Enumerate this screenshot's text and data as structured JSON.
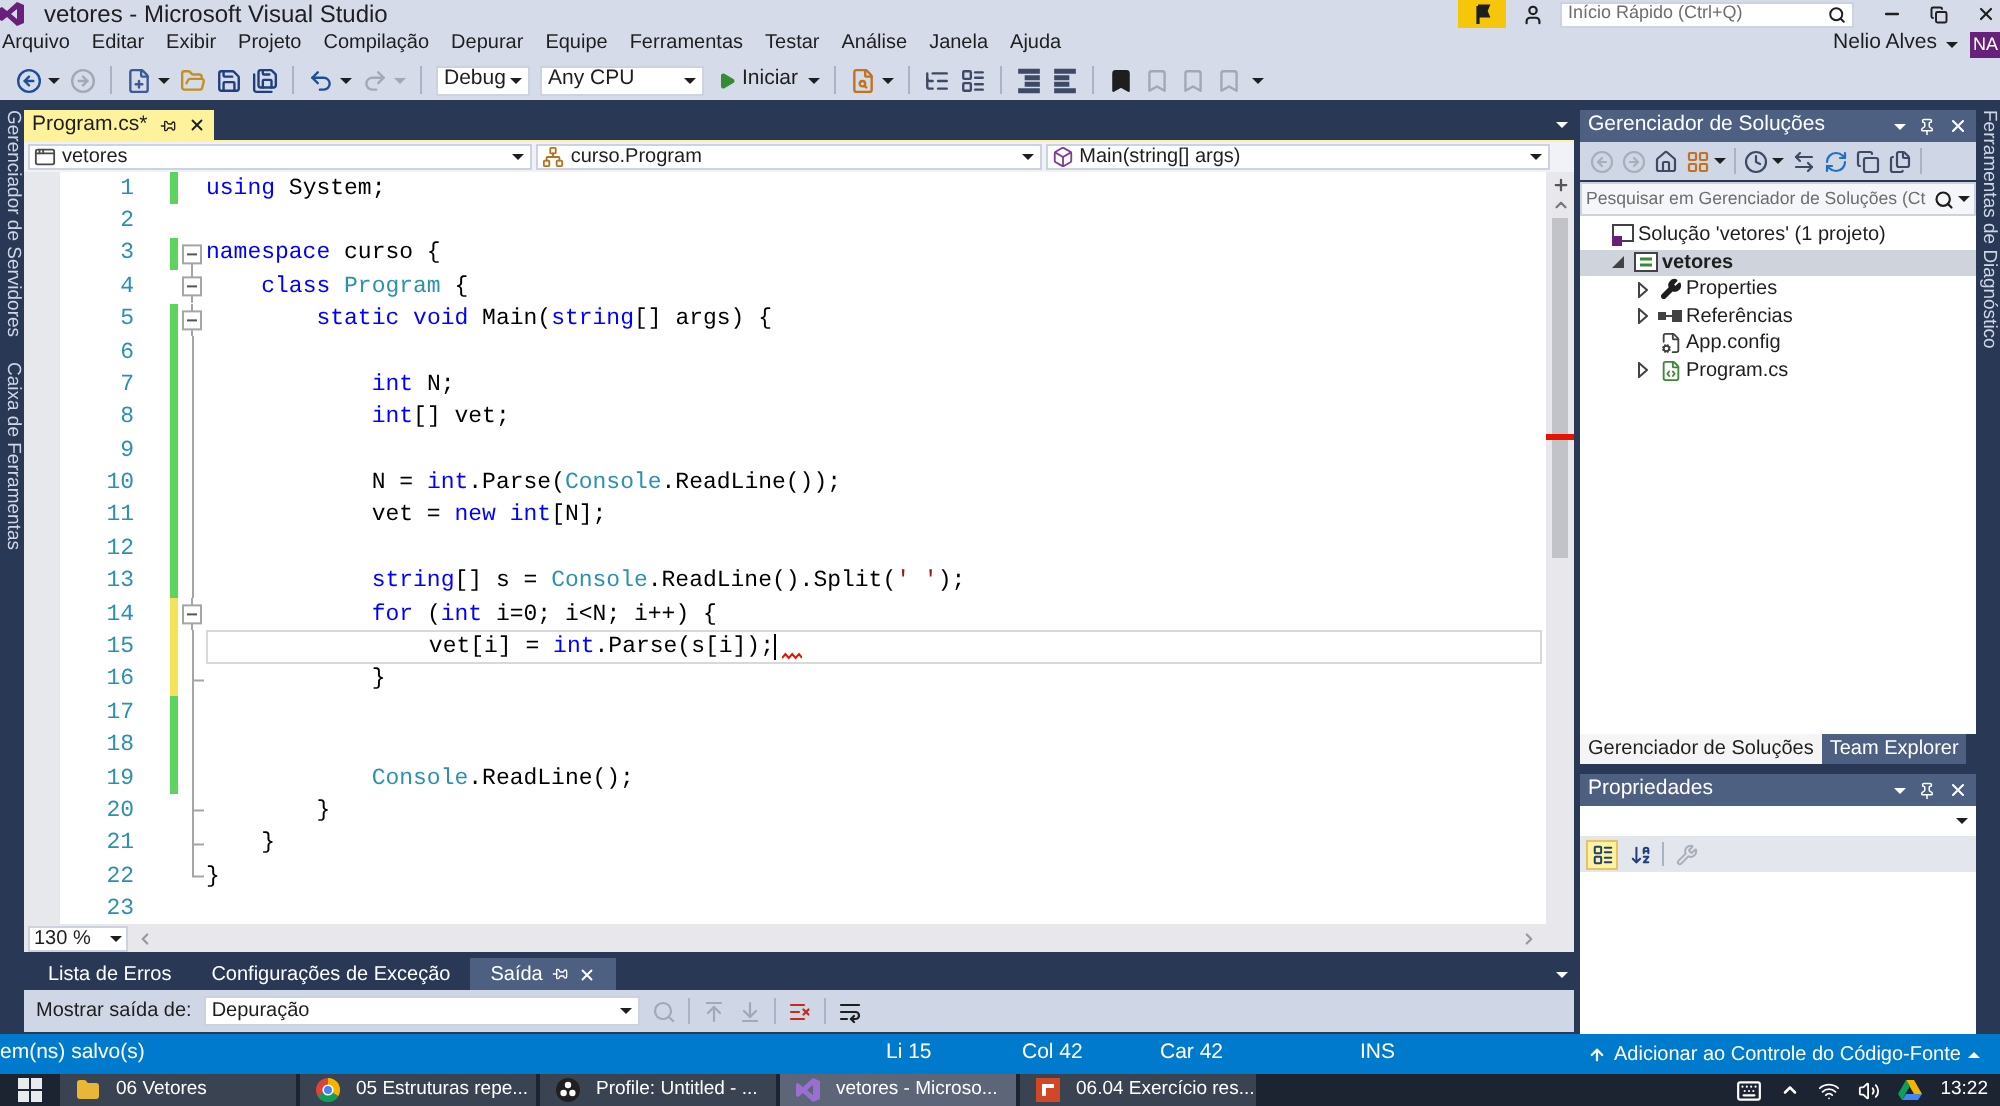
{
  "window": {
    "title": "vetores - Microsoft Visual Studio",
    "quick_launch": {
      "placeholder": "Início Rápido (Ctrl+Q)"
    }
  },
  "menu": [
    "Arquivo",
    "Editar",
    "Exibir",
    "Projeto",
    "Compilação",
    "Depurar",
    "Equipe",
    "Ferramentas",
    "Testar",
    "Análise",
    "Janela",
    "Ajuda"
  ],
  "account": {
    "name": "Nelio Alves",
    "initials": "NA"
  },
  "toolbar": [
    {
      "kind": "back",
      "disabled": false,
      "dropdown": true
    },
    {
      "kind": "forward",
      "disabled": true,
      "dropdown": false
    },
    {
      "kind": "separator"
    },
    {
      "kind": "new-project",
      "disabled": false,
      "dropdown": true
    },
    {
      "kind": "open",
      "disabled": false,
      "dropdown": false
    },
    {
      "kind": "save",
      "disabled": false,
      "dropdown": false
    },
    {
      "kind": "save-all",
      "disabled": false,
      "dropdown": false
    },
    {
      "kind": "separator"
    },
    {
      "kind": "undo",
      "disabled": false,
      "dropdown": true
    },
    {
      "kind": "redo",
      "disabled": true,
      "dropdown": true
    },
    {
      "kind": "separator"
    },
    {
      "kind": "select",
      "value": "Debug"
    },
    {
      "kind": "select",
      "value": "Any CPU"
    },
    {
      "kind": "start",
      "label": "Iniciar",
      "dropdown": true
    },
    {
      "kind": "separator"
    },
    {
      "kind": "find",
      "disabled": false,
      "dropdown": true
    },
    {
      "kind": "separator"
    },
    {
      "kind": "tree",
      "disabled": false,
      "dropdown": false
    },
    {
      "kind": "list",
      "disabled": false,
      "dropdown": false
    },
    {
      "kind": "separator"
    },
    {
      "kind": "comment",
      "disabled": false,
      "dropdown": false
    },
    {
      "kind": "uncomment",
      "disabled": false,
      "dropdown": false
    },
    {
      "kind": "separator"
    },
    {
      "kind": "bookmark",
      "disabled": false,
      "dropdown": false
    },
    {
      "kind": "bookmark-prev",
      "disabled": true,
      "dropdown": false
    },
    {
      "kind": "bookmark-next",
      "disabled": true,
      "dropdown": false
    },
    {
      "kind": "bookmark-clear",
      "disabled": true,
      "dropdown": false
    },
    {
      "kind": "overflow"
    }
  ],
  "side_tabs": {
    "left": [
      "Gerenciador de Servidores",
      "Caixa de Ferramentas"
    ],
    "right": [
      "Ferramentas de Diagnóstico"
    ]
  },
  "editor": {
    "tabs": [
      {
        "label": "Program.cs*",
        "selected": true
      }
    ],
    "navigation": [
      {
        "kind": "project",
        "value": "vetores"
      },
      {
        "kind": "class",
        "value": "curso.Program"
      },
      {
        "kind": "method",
        "value": "Main(string[] args)"
      }
    ],
    "lines": [
      {
        "number": "1",
        "color": "#5fd35f",
        "fold": false,
        "fold_end": false,
        "in_fold": false,
        "current": false,
        "error": false,
        "tokens": [
          {
            "kind": "keyword",
            "text": "using"
          },
          {
            "kind": "plain",
            "text": " System;"
          }
        ]
      },
      {
        "number": "2",
        "fold": false,
        "fold_end": false,
        "in_fold": false,
        "current": false,
        "error": false
      },
      {
        "number": "3",
        "color": "#5fd35f",
        "fold": true,
        "fold_end": false,
        "in_fold": false,
        "current": false,
        "error": false,
        "tokens": [
          {
            "kind": "keyword",
            "text": "namespace"
          },
          {
            "kind": "plain",
            "text": " curso {"
          }
        ]
      },
      {
        "number": "4",
        "fold": true,
        "fold_end": false,
        "in_fold": true,
        "current": false,
        "error": false,
        "tokens": [
          {
            "kind": "keyword",
            "text": "    class"
          },
          {
            "kind": "type",
            "text": " Program"
          },
          {
            "kind": "plain",
            "text": " {"
          }
        ]
      },
      {
        "number": "5",
        "color": "#5fd35f",
        "fold": true,
        "fold_end": false,
        "in_fold": true,
        "current": false,
        "error": false,
        "tokens": [
          {
            "kind": "keyword",
            "text": "        static"
          },
          {
            "kind": "keyword",
            "text": " void"
          },
          {
            "kind": "plain",
            "text": " Main("
          },
          {
            "kind": "keyword",
            "text": "string"
          },
          {
            "kind": "plain",
            "text": "[] args) {"
          }
        ]
      },
      {
        "number": "6",
        "color": "#5fd35f",
        "fold": false,
        "fold_end": false,
        "in_fold": true,
        "current": false,
        "error": false
      },
      {
        "number": "7",
        "color": "#5fd35f",
        "fold": false,
        "fold_end": false,
        "in_fold": true,
        "current": false,
        "error": false,
        "tokens": [
          {
            "kind": "keyword",
            "text": "            int"
          },
          {
            "kind": "plain",
            "text": " N;"
          }
        ]
      },
      {
        "number": "8",
        "color": "#5fd35f",
        "fold": false,
        "fold_end": false,
        "in_fold": true,
        "current": false,
        "error": false,
        "tokens": [
          {
            "kind": "keyword",
            "text": "            int"
          },
          {
            "kind": "plain",
            "text": "[] vet;"
          }
        ]
      },
      {
        "number": "9",
        "color": "#5fd35f",
        "fold": false,
        "fold_end": false,
        "in_fold": true,
        "current": false,
        "error": false
      },
      {
        "number": "10",
        "color": "#5fd35f",
        "fold": false,
        "fold_end": false,
        "in_fold": true,
        "current": false,
        "error": false,
        "tokens": [
          {
            "kind": "plain",
            "text": "            N = "
          },
          {
            "kind": "keyword",
            "text": "int"
          },
          {
            "kind": "plain",
            "text": ".Parse("
          },
          {
            "kind": "type",
            "text": "Console"
          },
          {
            "kind": "plain",
            "text": ".ReadLine());"
          }
        ]
      },
      {
        "number": "11",
        "color": "#5fd35f",
        "fold": false,
        "fold_end": false,
        "in_fold": true,
        "current": false,
        "error": false,
        "tokens": [
          {
            "kind": "plain",
            "text": "            vet = "
          },
          {
            "kind": "keyword",
            "text": "new"
          },
          {
            "kind": "keyword",
            "text": " int"
          },
          {
            "kind": "plain",
            "text": "[N];"
          }
        ]
      },
      {
        "number": "12",
        "color": "#5fd35f",
        "fold": false,
        "fold_end": false,
        "in_fold": true,
        "current": false,
        "error": false
      },
      {
        "number": "13",
        "color": "#5fd35f",
        "fold": false,
        "fold_end": false,
        "in_fold": true,
        "current": false,
        "error": false,
        "tokens": [
          {
            "kind": "keyword",
            "text": "            string"
          },
          {
            "kind": "plain",
            "text": "[] s = "
          },
          {
            "kind": "type",
            "text": "Console"
          },
          {
            "kind": "plain",
            "text": ".ReadLine().Split("
          },
          {
            "kind": "string",
            "text": "' '"
          },
          {
            "kind": "plain",
            "text": ");"
          }
        ]
      },
      {
        "number": "14",
        "color": "#f3e35a",
        "fold": true,
        "fold_end": false,
        "in_fold": true,
        "current": false,
        "error": false,
        "tokens": [
          {
            "kind": "keyword",
            "text": "            for"
          },
          {
            "kind": "plain",
            "text": " ("
          },
          {
            "kind": "keyword",
            "text": "int"
          },
          {
            "kind": "plain",
            "text": " i=0; i<N; i++) {"
          }
        ]
      },
      {
        "number": "15",
        "color": "#f3e35a",
        "fold": false,
        "fold_end": false,
        "in_fold": true,
        "current": true,
        "error": true,
        "tokens": [
          {
            "kind": "plain",
            "text": "                vet[i] = "
          },
          {
            "kind": "keyword",
            "text": "int"
          },
          {
            "kind": "plain",
            "text": ".Parse(s[i]);"
          }
        ]
      },
      {
        "number": "16",
        "color": "#f3e35a",
        "fold": false,
        "fold_end": true,
        "in_fold": true,
        "current": false,
        "error": false,
        "tokens": [
          {
            "kind": "plain",
            "text": "            }"
          }
        ]
      },
      {
        "number": "17",
        "color": "#5fd35f",
        "fold": false,
        "fold_end": false,
        "in_fold": true,
        "current": false,
        "error": false
      },
      {
        "number": "18",
        "color": "#5fd35f",
        "fold": false,
        "fold_end": false,
        "in_fold": true,
        "current": false,
        "error": false
      },
      {
        "number": "19",
        "color": "#5fd35f",
        "fold": false,
        "fold_end": false,
        "in_fold": true,
        "current": false,
        "error": false,
        "tokens": [
          {
            "kind": "type",
            "text": "            Console"
          },
          {
            "kind": "plain",
            "text": ".ReadLine();"
          }
        ]
      },
      {
        "number": "20",
        "fold": false,
        "fold_end": true,
        "in_fold": true,
        "current": false,
        "error": false,
        "tokens": [
          {
            "kind": "plain",
            "text": "        }"
          }
        ]
      },
      {
        "number": "21",
        "fold": false,
        "fold_end": true,
        "in_fold": true,
        "current": false,
        "error": false,
        "tokens": [
          {
            "kind": "plain",
            "text": "    }"
          }
        ]
      },
      {
        "number": "22",
        "fold": false,
        "fold_end": true,
        "in_fold": false,
        "current": false,
        "error": false,
        "tokens": [
          {
            "kind": "plain",
            "text": "}"
          }
        ]
      },
      {
        "number": "23",
        "fold": false,
        "fold_end": false,
        "in_fold": false,
        "current": false,
        "error": false
      }
    ],
    "zoom": "130 %"
  },
  "output": {
    "tabs": [
      {
        "label": "Lista de Erros",
        "selected": false
      },
      {
        "label": "Configurações de Exceção",
        "selected": false
      },
      {
        "label": "Saída",
        "selected": true
      }
    ],
    "source_label": "Mostrar saída de:",
    "source": "Depuração",
    "toolbar": [
      {
        "kind": "find",
        "disabled": true
      },
      {
        "kind": "separator"
      },
      {
        "kind": "previous",
        "disabled": true
      },
      {
        "kind": "next",
        "disabled": true
      },
      {
        "kind": "separator"
      },
      {
        "kind": "clear",
        "disabled": false
      },
      {
        "kind": "separator"
      },
      {
        "kind": "word-wrap",
        "disabled": false
      }
    ]
  },
  "solution_explorer": {
    "title": "Gerenciador de Soluções",
    "toolbar": [
      {
        "kind": "back",
        "disabled": true,
        "dropdown": false
      },
      {
        "kind": "forward",
        "disabled": true,
        "dropdown": false
      },
      {
        "kind": "home",
        "disabled": false,
        "dropdown": false
      },
      {
        "kind": "switch-views",
        "disabled": false,
        "dropdown": true
      },
      {
        "kind": "separator"
      },
      {
        "kind": "pending-changes",
        "disabled": false,
        "dropdown": true
      },
      {
        "kind": "sync",
        "disabled": false,
        "dropdown": false
      },
      {
        "kind": "refresh",
        "disabled": false,
        "dropdown": false
      },
      {
        "kind": "collapse-all",
        "disabled": false,
        "dropdown": false
      },
      {
        "kind": "show-all-files",
        "disabled": false,
        "dropdown": false
      },
      {
        "kind": "separator"
      }
    ],
    "search": {
      "placeholder": "Pesquisar em Gerenciador de Soluções (Ct"
    },
    "tree": [
      {
        "kind": "solution",
        "label": "Solução 'vetores' (1 projeto)",
        "selected": false,
        "startup": false,
        "children": [
          {
            "kind": "project",
            "label": "vetores",
            "expanded": true,
            "selected": true,
            "startup": true,
            "children": [
              {
                "kind": "properties",
                "label": "Properties",
                "expanded": false,
                "selected": false,
                "startup": false
              },
              {
                "kind": "references",
                "label": "Referências",
                "expanded": false,
                "selected": false,
                "startup": false
              },
              {
                "kind": "config",
                "label": "App.config",
                "selected": false,
                "startup": false
              },
              {
                "kind": "code-file",
                "label": "Program.cs",
                "expanded": false,
                "selected": false,
                "startup": false
              }
            ]
          }
        ]
      }
    ],
    "tabs": [
      {
        "label": "Gerenciador de Soluções",
        "selected": true
      },
      {
        "label": "Team Explorer",
        "selected": false
      }
    ]
  },
  "properties": {
    "title": "Propriedades",
    "toolbar": [
      {
        "kind": "categorized",
        "selected": true,
        "disabled": false
      },
      {
        "kind": "alphabetical",
        "selected": false,
        "disabled": false
      },
      {
        "kind": "separator"
      },
      {
        "kind": "property-pages",
        "selected": false,
        "disabled": true
      }
    ]
  },
  "status_bar": {
    "message": "em(ns) salvo(s)",
    "line": "Li 15",
    "column": "Col 42",
    "character": "Car 42",
    "mode": "INS",
    "source_control": "Adicionar ao Controle do Código-Fonte"
  },
  "taskbar": {
    "items": [
      {
        "kind": "folder",
        "label": "06 Vetores",
        "selected": false
      },
      {
        "kind": "browser",
        "label": "05 Estruturas repe...",
        "selected": false
      },
      {
        "kind": "recorder",
        "label": "Profile: Untitled - ...",
        "selected": false
      },
      {
        "kind": "ide",
        "label": "vetores - Microso...",
        "selected": true
      },
      {
        "kind": "slides",
        "label": "06.04 Exercício res...",
        "selected": false
      }
    ],
    "clock": "13:22"
  }
}
